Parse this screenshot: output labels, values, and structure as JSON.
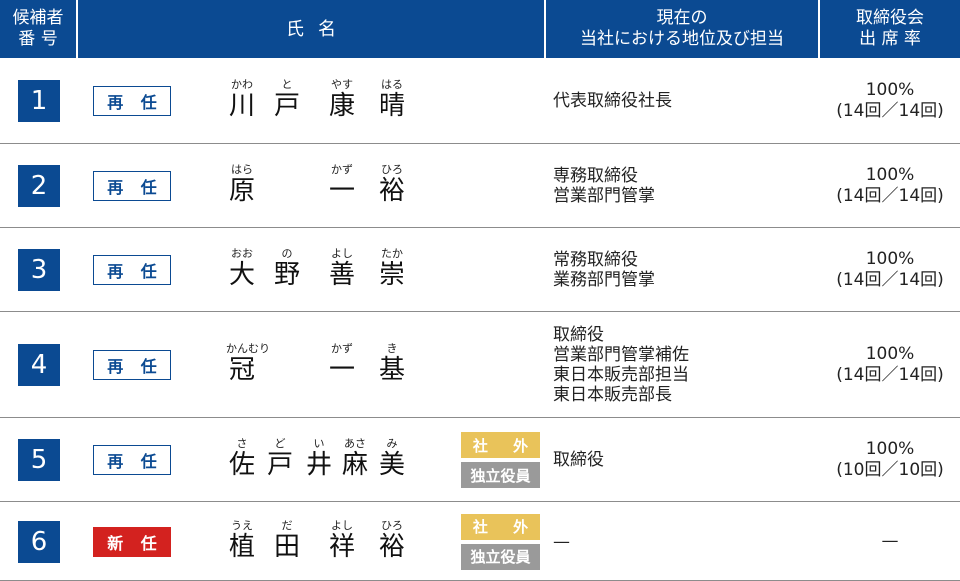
{
  "header": {
    "num_line1": "候補者",
    "num_line2": "番 号",
    "name": "氏名",
    "position_line1": "現在の",
    "position_line2": "当社における地位及び担当",
    "attendance_line1": "取締役会",
    "attendance_line2": "出 席 率"
  },
  "rows": [
    {
      "num": "1",
      "status": "再 任",
      "is_new": false,
      "chars": [
        {
          "kanji": "川",
          "ruby": "かわ"
        },
        {
          "kanji": "戸",
          "ruby": "と"
        },
        {
          "kanji": "康",
          "ruby": "やす"
        },
        {
          "kanji": "晴",
          "ruby": "はる"
        }
      ],
      "outside": null,
      "position": [
        "代表取締役社長"
      ],
      "attendance": [
        "100%",
        "(14回／14回)"
      ]
    },
    {
      "num": "2",
      "status": "再 任",
      "is_new": false,
      "chars": [
        {
          "kanji": "原",
          "ruby": "はら"
        },
        {
          "kanji": "",
          "ruby": ""
        },
        {
          "kanji": "一",
          "ruby": "かず"
        },
        {
          "kanji": "裕",
          "ruby": "ひろ"
        }
      ],
      "outside": null,
      "position": [
        "専務取締役",
        "営業部門管掌"
      ],
      "attendance": [
        "100%",
        "(14回／14回)"
      ]
    },
    {
      "num": "3",
      "status": "再 任",
      "is_new": false,
      "chars": [
        {
          "kanji": "大",
          "ruby": "おお"
        },
        {
          "kanji": "野",
          "ruby": "の"
        },
        {
          "kanji": "善",
          "ruby": "よし"
        },
        {
          "kanji": "崇",
          "ruby": "たか"
        }
      ],
      "outside": null,
      "position": [
        "常務取締役",
        "業務部門管掌"
      ],
      "attendance": [
        "100%",
        "(14回／14回)"
      ]
    },
    {
      "num": "4",
      "status": "再 任",
      "is_new": false,
      "chars": [
        {
          "kanji": "冠",
          "ruby": "かんむり"
        },
        {
          "kanji": "",
          "ruby": ""
        },
        {
          "kanji": "一",
          "ruby": "かず"
        },
        {
          "kanji": "基",
          "ruby": "き"
        }
      ],
      "outside": null,
      "position": [
        "取締役",
        "営業部門管掌補佐",
        "東日本販売部担当",
        "東日本販売部長"
      ],
      "attendance": [
        "100%",
        "(14回／14回)"
      ]
    },
    {
      "num": "5",
      "status": "再 任",
      "is_new": false,
      "chars": [
        {
          "kanji": "佐",
          "ruby": "さ"
        },
        {
          "kanji": "戸",
          "ruby": "ど"
        },
        {
          "kanji": "井",
          "ruby": "い"
        },
        {
          "kanji": "麻",
          "ruby": "あさ"
        },
        {
          "kanji": "美",
          "ruby": "み"
        }
      ],
      "outside": {
        "line1": "社 外",
        "line2": "独立役員"
      },
      "position": [
        "取締役"
      ],
      "attendance": [
        "100%",
        "(10回／10回)"
      ]
    },
    {
      "num": "6",
      "status": "新 任",
      "is_new": true,
      "chars": [
        {
          "kanji": "植",
          "ruby": "うえ"
        },
        {
          "kanji": "田",
          "ruby": "だ"
        },
        {
          "kanji": "祥",
          "ruby": "よし"
        },
        {
          "kanji": "裕",
          "ruby": "ひろ"
        }
      ],
      "outside": {
        "line1": "社 外",
        "line2": "独立役員"
      },
      "position": [
        "—"
      ],
      "attendance": [
        "—"
      ]
    }
  ],
  "colors": {
    "header_bg": "#0b4a92",
    "new_badge": "#d3221f",
    "outside_badge": "#e9c35a",
    "independent_badge": "#9a9a9a"
  }
}
